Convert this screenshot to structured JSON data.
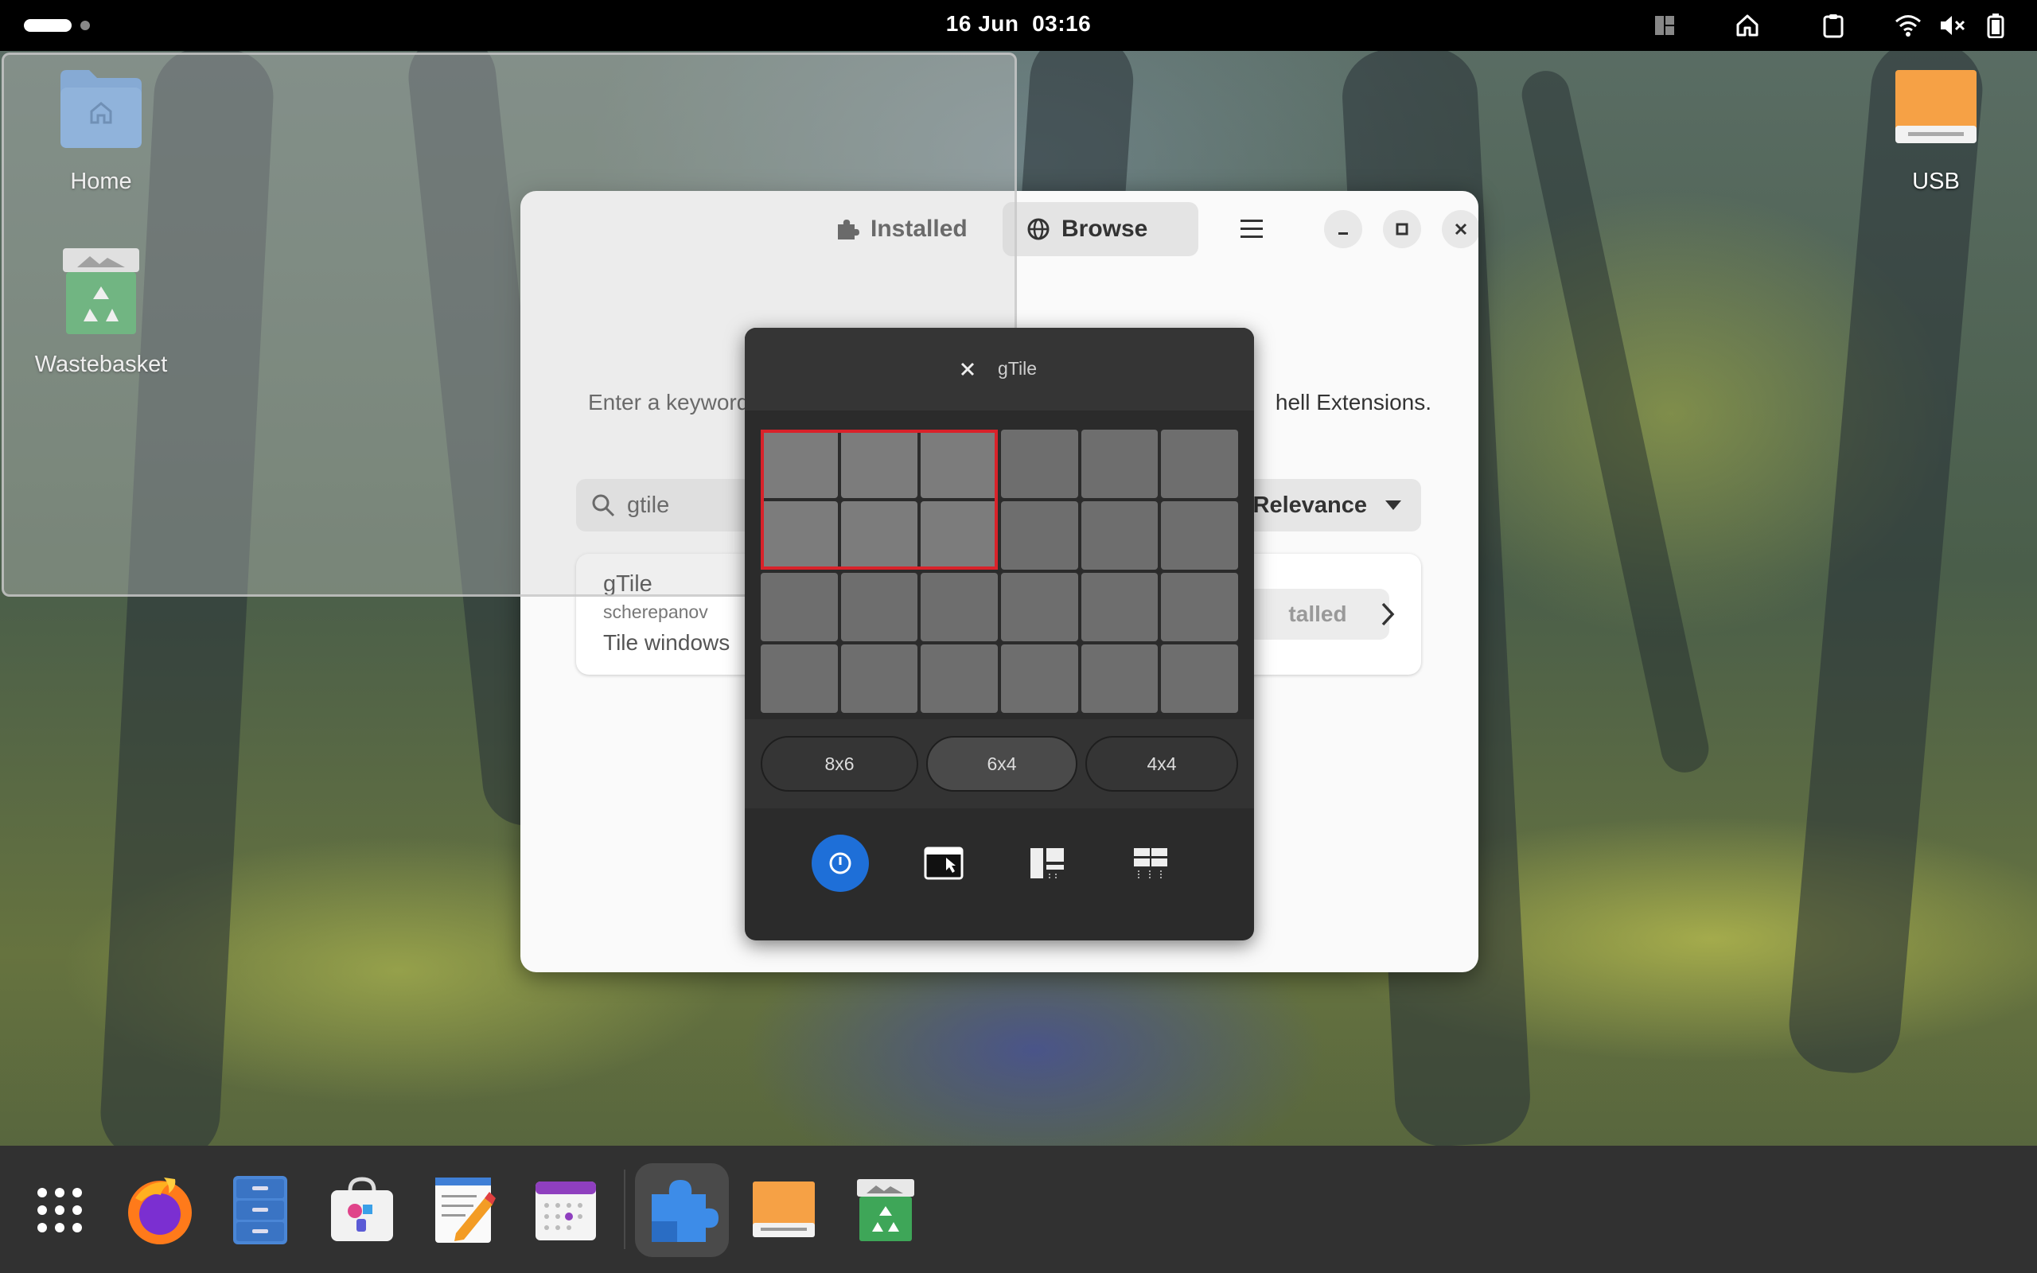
{
  "topbar": {
    "date": "16 Jun",
    "time": "03:16"
  },
  "desktop": {
    "icons": [
      {
        "label": "Home"
      },
      {
        "label": "Wastebasket"
      },
      {
        "label": "USB"
      }
    ]
  },
  "window": {
    "tabs": [
      {
        "label": "Installed",
        "active": false
      },
      {
        "label": "Browse",
        "active": true
      }
    ],
    "hint_left": "Enter a keyword",
    "hint_right": "hell Extensions.",
    "search": {
      "value": "gtile"
    },
    "sort": {
      "label": "Relevance"
    },
    "result": {
      "name": "gTile",
      "author": "scherepanov",
      "description": "Tile windows",
      "status": "talled"
    }
  },
  "gtile": {
    "title": "gTile",
    "grid": {
      "columns": 6,
      "rows": 4,
      "selected_columns": 3,
      "selected_rows": 2
    },
    "presets": [
      {
        "label": "8x6",
        "active": false
      },
      {
        "label": "6x4",
        "active": true
      },
      {
        "label": "4x4",
        "active": false
      }
    ],
    "actions": [
      "power-icon",
      "window-pointer-icon",
      "auto-tile-main-icon",
      "auto-tile-columns-icon"
    ]
  },
  "dock": {
    "items": [
      "app-grid-icon",
      "firefox-icon",
      "file-cabinet-icon",
      "software-store-icon",
      "text-editor-icon",
      "calendar-icon",
      "extensions-icon",
      "usb-drive-icon",
      "wastebasket-icon"
    ],
    "running": "extensions-icon"
  },
  "colors": {
    "accent": "#1e6fd8",
    "grid_selection": "#d9222a",
    "dock_bg": "#313131"
  }
}
